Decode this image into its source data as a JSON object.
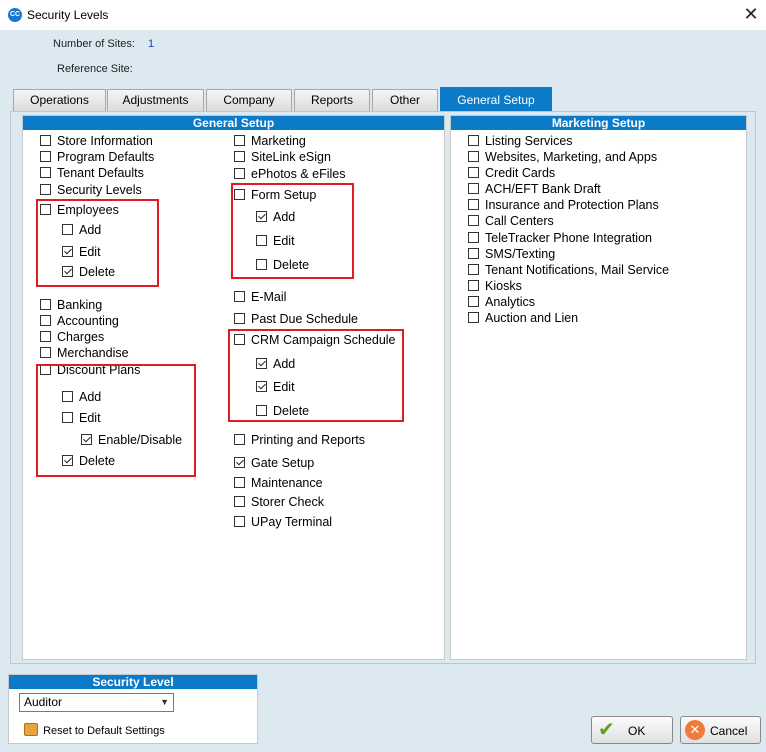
{
  "window": {
    "title": "Security Levels",
    "app_icon": "CC"
  },
  "header": {
    "sites_label": "Number of Sites:",
    "sites_value": "1",
    "reference_label": "Reference Site:"
  },
  "tabs": [
    {
      "label": "Operations"
    },
    {
      "label": "Adjustments"
    },
    {
      "label": "Company"
    },
    {
      "label": "Reports"
    },
    {
      "label": "Other"
    },
    {
      "label": "General Setup",
      "active": true
    }
  ],
  "general_setup": {
    "title": "General Setup",
    "col1": {
      "store_information": "Store Information",
      "program_defaults": "Program Defaults",
      "tenant_defaults": "Tenant Defaults",
      "security_levels": "Security Levels",
      "employees": "Employees",
      "employees_add": "Add",
      "employees_edit": "Edit",
      "employees_delete": "Delete",
      "banking": "Banking",
      "accounting": "Accounting",
      "charges": "Charges",
      "merchandise": "Merchandise",
      "discount_plans": "Discount Plans",
      "discount_add": "Add",
      "discount_edit": "Edit",
      "discount_enable_disable": "Enable/Disable",
      "discount_delete": "Delete"
    },
    "col2": {
      "marketing": "Marketing",
      "sitelink_esign": "SiteLink eSign",
      "ephotos_efiles": "ePhotos & eFiles",
      "form_setup": "Form Setup",
      "form_add": "Add",
      "form_edit": "Edit",
      "form_delete": "Delete",
      "email": "E-Mail",
      "past_due_schedule": "Past Due Schedule",
      "crm_campaign_schedule": "CRM Campaign Schedule",
      "crm_add": "Add",
      "crm_edit": "Edit",
      "crm_delete": "Delete",
      "printing_and_reports": "Printing and Reports",
      "gate_setup": "Gate Setup",
      "maintenance": "Maintenance",
      "storer_check": "Storer Check",
      "upay_terminal": "UPay Terminal"
    }
  },
  "marketing_setup": {
    "title": "Marketing Setup",
    "items": {
      "listing_services": "Listing Services",
      "websites": "Websites, Marketing, and Apps",
      "credit_cards": "Credit Cards",
      "ach_eft": "ACH/EFT Bank Draft",
      "insurance": "Insurance and Protection Plans",
      "call_centers": "Call Centers",
      "teletracker": "TeleTracker Phone Integration",
      "sms": "SMS/Texting",
      "tenant_notifications": "Tenant Notifications, Mail Service",
      "kiosks": "Kiosks",
      "analytics": "Analytics",
      "auction": "Auction and Lien"
    }
  },
  "security_level": {
    "title": "Security Level",
    "selected": "Auditor",
    "reset_label": "Reset to Default Settings"
  },
  "buttons": {
    "ok": "OK",
    "cancel": "Cancel"
  },
  "colors": {
    "accent": "#0b7ac8",
    "highlight_box": "#e01b24",
    "background": "#dce9f1"
  }
}
